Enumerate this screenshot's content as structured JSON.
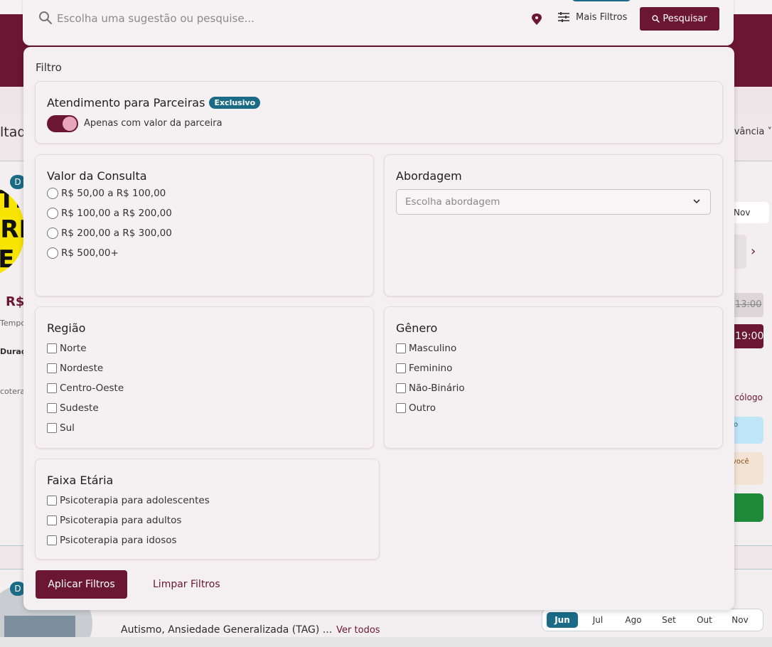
{
  "search": {
    "placeholder": "Escolha uma sugestão ou pesquise...",
    "more_filters_label": "Mais Filtros",
    "search_button_label": "Pesquisar"
  },
  "background": {
    "left_title": "ltad",
    "sort_label": "vância",
    "price": "R$",
    "tempo": "Tempo",
    "duracao": "Duraçã",
    "psicotera": "coterap",
    "month_nov": "Nov",
    "time_crossed": "13:00",
    "time_available": "19:00",
    "psicologo": "icólogo",
    "blue_card_text": "o",
    "beige_card_text": "você",
    "specialties": "Autismo, Ansiedade Generalizada (TAG) ...",
    "see_all": "Ver todos",
    "months": [
      "Jun",
      "Jul",
      "Ago",
      "Set",
      "Out",
      "Nov"
    ],
    "active_month": "Jun",
    "badge_d": "D"
  },
  "filter": {
    "title": "Filtro",
    "partners": {
      "title": "Atendimento para Parceiras",
      "badge": "Exclusivo",
      "toggle_label": "Apenas com valor da parceira",
      "toggle_on": true
    },
    "consultation_value": {
      "title": "Valor da Consulta",
      "options": [
        "R$ 50,00 a R$ 100,00",
        "R$ 100,00 a R$ 200,00",
        "R$ 200,00 a R$ 300,00",
        "R$ 500,00+"
      ]
    },
    "approach": {
      "title": "Abordagem",
      "placeholder": "Escolha abordagem"
    },
    "region": {
      "title": "Região",
      "options": [
        "Norte",
        "Nordeste",
        "Centro-Oeste",
        "Sudeste",
        "Sul"
      ]
    },
    "gender": {
      "title": "Gênero",
      "options": [
        "Masculino",
        "Feminino",
        "Não-Binário",
        "Outro"
      ]
    },
    "age_group": {
      "title": "Faixa Etária",
      "options": [
        "Psicoterapia para adolescentes",
        "Psicoterapia para adultos",
        "Psicoterapia para idosos"
      ]
    },
    "apply_label": "Aplicar Filtros",
    "clear_label": "Limpar Filtros"
  },
  "colors": {
    "brand": "#6b1632",
    "accent": "#1b6b87"
  }
}
